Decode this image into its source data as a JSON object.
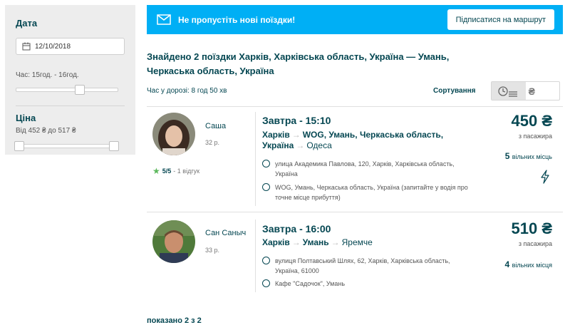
{
  "sidebar": {
    "date_label": "Дата",
    "date_value": "12/10/2018",
    "time_label": "Час: 15год. - 16год.",
    "price_label": "Ціна",
    "price_range": "Від 452 ₴ до 517 ₴"
  },
  "banner": {
    "text": "Не пропустіть нові поїздки!",
    "subscribe_label": "Підписатися на маршрут"
  },
  "results": {
    "title": "Знайдено 2 поїздки Харків, Харківська область, Україна — Умань, Черкаська область, Україна",
    "travel_time": "Час у дорозі: 8 год 50 хв",
    "sort_label": "Сортування",
    "sort_price_symbol": "₴",
    "shown_count": "показано 2 з 2"
  },
  "trips": [
    {
      "driver": "Саша",
      "age": "32 р.",
      "rating_score": "5/5",
      "rating_reviews": "- 1 відгук",
      "time": "Завтра - 15:10",
      "from": "Харків",
      "to": "WOG, Умань, Черкаська область, Україна",
      "extra_dest": "Одеса",
      "stop1": "улица Академика Павлова, 120, Харків, Харківська область, Україна",
      "stop2": "WOG, Умань, Черкаська область, Україна (запитайте у водія про точне місце прибуття)",
      "price": "450 ₴",
      "per_passenger": "з пасажира",
      "seats_num": "5",
      "seats_label": "вільних місць"
    },
    {
      "driver": "Сан Саныч",
      "age": "33 р.",
      "time": "Завтра - 16:00",
      "from": "Харків",
      "to": "Умань",
      "extra_dest": "Яремче",
      "stop1": "вулиця Полтавський Шлях, 62, Харків, Харківська область, Україна, 61000",
      "stop2": "Кафе \"Садочок\", Умань",
      "price": "510 ₴",
      "per_passenger": "з пасажира",
      "seats_num": "4",
      "seats_label": "вільних місця"
    }
  ],
  "colors": {
    "brand_blue": "#00aff5",
    "text_dark": "#054752",
    "star_green": "#5cb85c"
  }
}
